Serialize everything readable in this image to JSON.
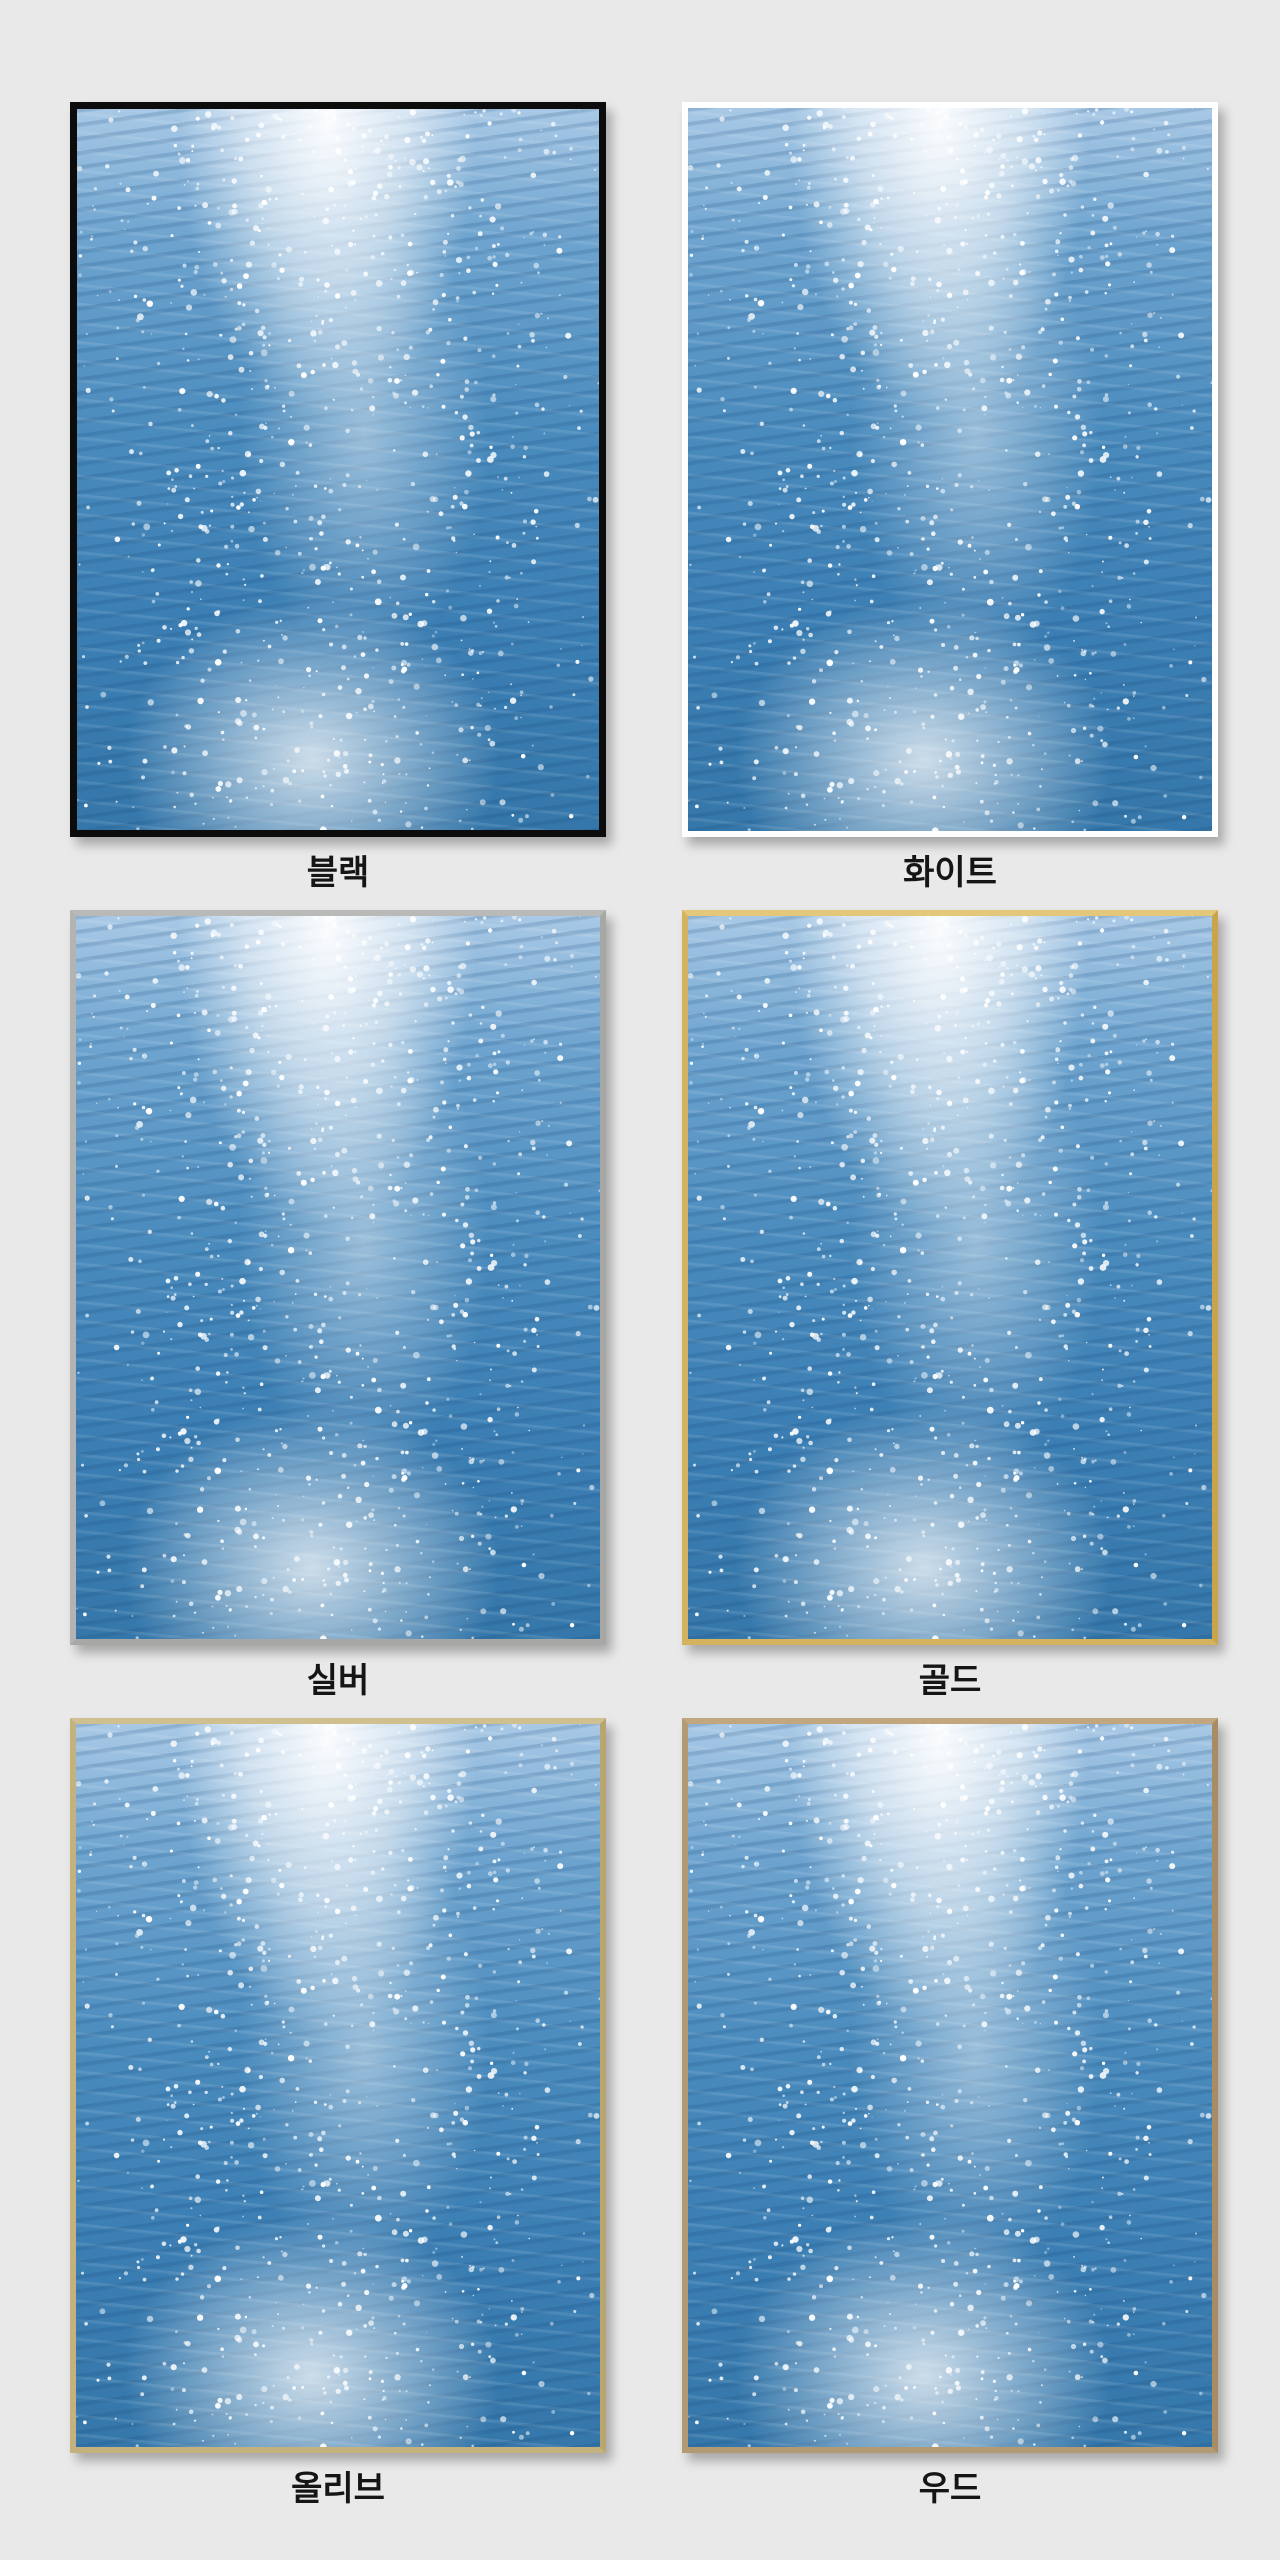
{
  "frames": [
    {
      "label": "블랙",
      "border_color": "#0c0c0c",
      "style": "black"
    },
    {
      "label": "화이트",
      "border_color": "#ffffff",
      "style": "white"
    },
    {
      "label": "실버",
      "border_color": "#a7a7a5",
      "style": "silver"
    },
    {
      "label": "골드",
      "border_color": "#d3b35f",
      "style": "gold"
    },
    {
      "label": "올리브",
      "border_color": "#c4b27e",
      "style": "olive"
    },
    {
      "label": "우드",
      "border_color": "#b49a72",
      "style": "wood"
    }
  ],
  "background_color": "#e9e9e9",
  "artwork": "sparkling-sea-water-photo"
}
